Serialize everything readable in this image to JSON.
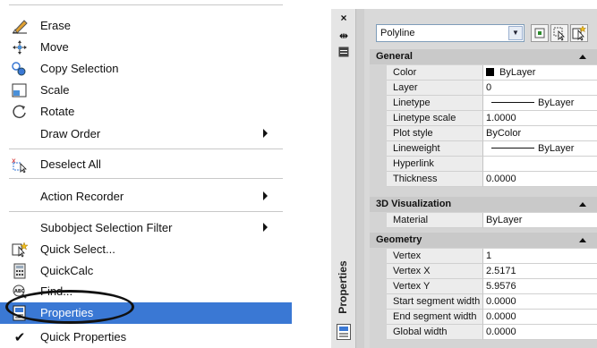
{
  "context_menu": {
    "items": [
      {
        "label": "Erase",
        "icon": "eraser-icon"
      },
      {
        "label": "Move",
        "icon": "move-arrows-icon"
      },
      {
        "label": "Copy Selection",
        "icon": "copy-selection-icon"
      },
      {
        "label": "Scale",
        "icon": "scale-icon"
      },
      {
        "label": "Rotate",
        "icon": "rotate-icon"
      },
      {
        "label": "Draw Order",
        "submenu": true
      },
      {
        "label": "Deselect All",
        "icon": "deselect-icon"
      },
      {
        "label": "Action Recorder",
        "submenu": true
      },
      {
        "label": "Subobject Selection Filter",
        "submenu": true
      },
      {
        "label": "Quick Select...",
        "icon": "quick-select-icon"
      },
      {
        "label": "QuickCalc",
        "icon": "calculator-icon"
      },
      {
        "label": "Find...",
        "icon": "find-text-icon"
      },
      {
        "label": "Properties",
        "icon": "properties-icon",
        "selected": true
      },
      {
        "label": "Quick Properties",
        "checked": true
      }
    ],
    "check_mark": "✔",
    "accent_color": "#3a78d4"
  },
  "palette": {
    "vertical_title": "Properties",
    "close_glyph": "×",
    "autohide_glyph": "⇹",
    "object_type": "Polyline",
    "categories": [
      {
        "name": "General",
        "rows": [
          {
            "name": "Color",
            "value": "ByLayer",
            "swatch": "#000000"
          },
          {
            "name": "Layer",
            "value": "0"
          },
          {
            "name": "Linetype",
            "value": "ByLayer",
            "line": true
          },
          {
            "name": "Linetype scale",
            "value": "1.0000"
          },
          {
            "name": "Plot style",
            "value": "ByColor"
          },
          {
            "name": "Lineweight",
            "value": "ByLayer",
            "line": true
          },
          {
            "name": "Hyperlink",
            "value": ""
          },
          {
            "name": "Thickness",
            "value": "0.0000"
          }
        ]
      },
      {
        "name": "3D Visualization",
        "rows": [
          {
            "name": "Material",
            "value": "ByLayer"
          }
        ]
      },
      {
        "name": "Geometry",
        "rows": [
          {
            "name": "Vertex",
            "value": "1"
          },
          {
            "name": "Vertex X",
            "value": "2.5171"
          },
          {
            "name": "Vertex Y",
            "value": "5.9576"
          },
          {
            "name": "Start segment width",
            "value": "0.0000"
          },
          {
            "name": "End segment width",
            "value": "0.0000"
          },
          {
            "name": "Global width",
            "value": "0.0000"
          }
        ]
      }
    ]
  }
}
